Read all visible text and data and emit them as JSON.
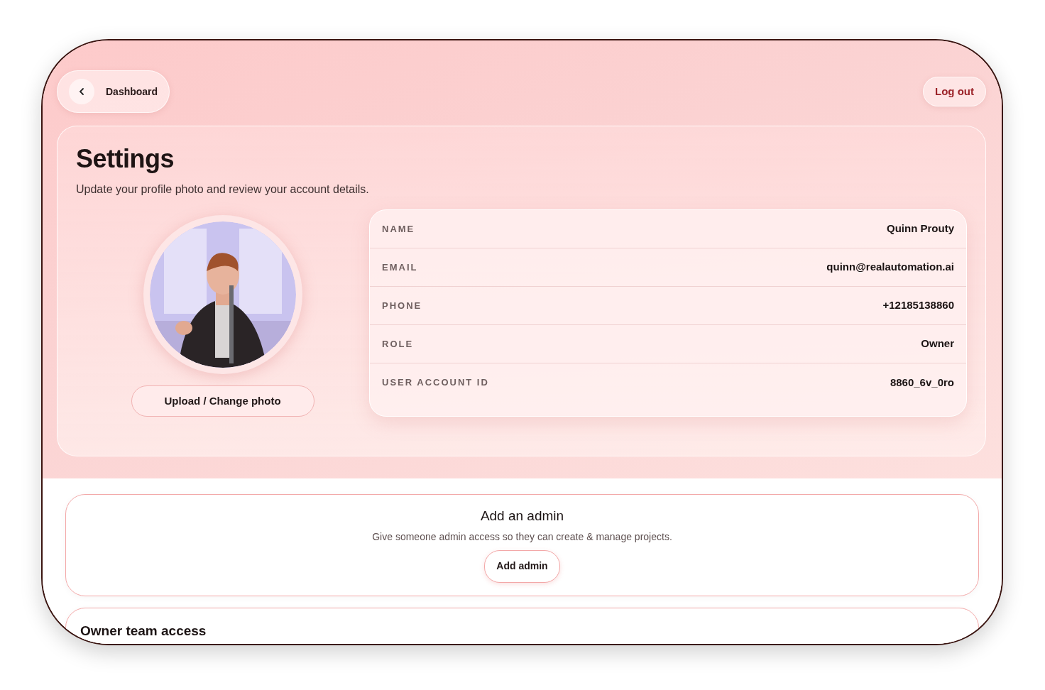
{
  "nav": {
    "back_label": "Dashboard",
    "logout_label": "Log out"
  },
  "settings": {
    "title": "Settings",
    "subtitle": "Update your profile photo and review your account details.",
    "upload_label": "Upload / Change photo",
    "details": [
      {
        "label": "NAME",
        "value": "Quinn Prouty"
      },
      {
        "label": "EMAIL",
        "value": "quinn@realautomation.ai"
      },
      {
        "label": "PHONE",
        "value": "+12185138860"
      },
      {
        "label": "ROLE",
        "value": "Owner"
      },
      {
        "label": "USER ACCOUNT ID",
        "value": "8860_6v_0ro"
      }
    ]
  },
  "add_admin": {
    "title": "Add an admin",
    "description": "Give someone admin access so they can create & manage projects.",
    "button": "Add admin"
  },
  "owner_team": {
    "title": "Owner team access"
  }
}
